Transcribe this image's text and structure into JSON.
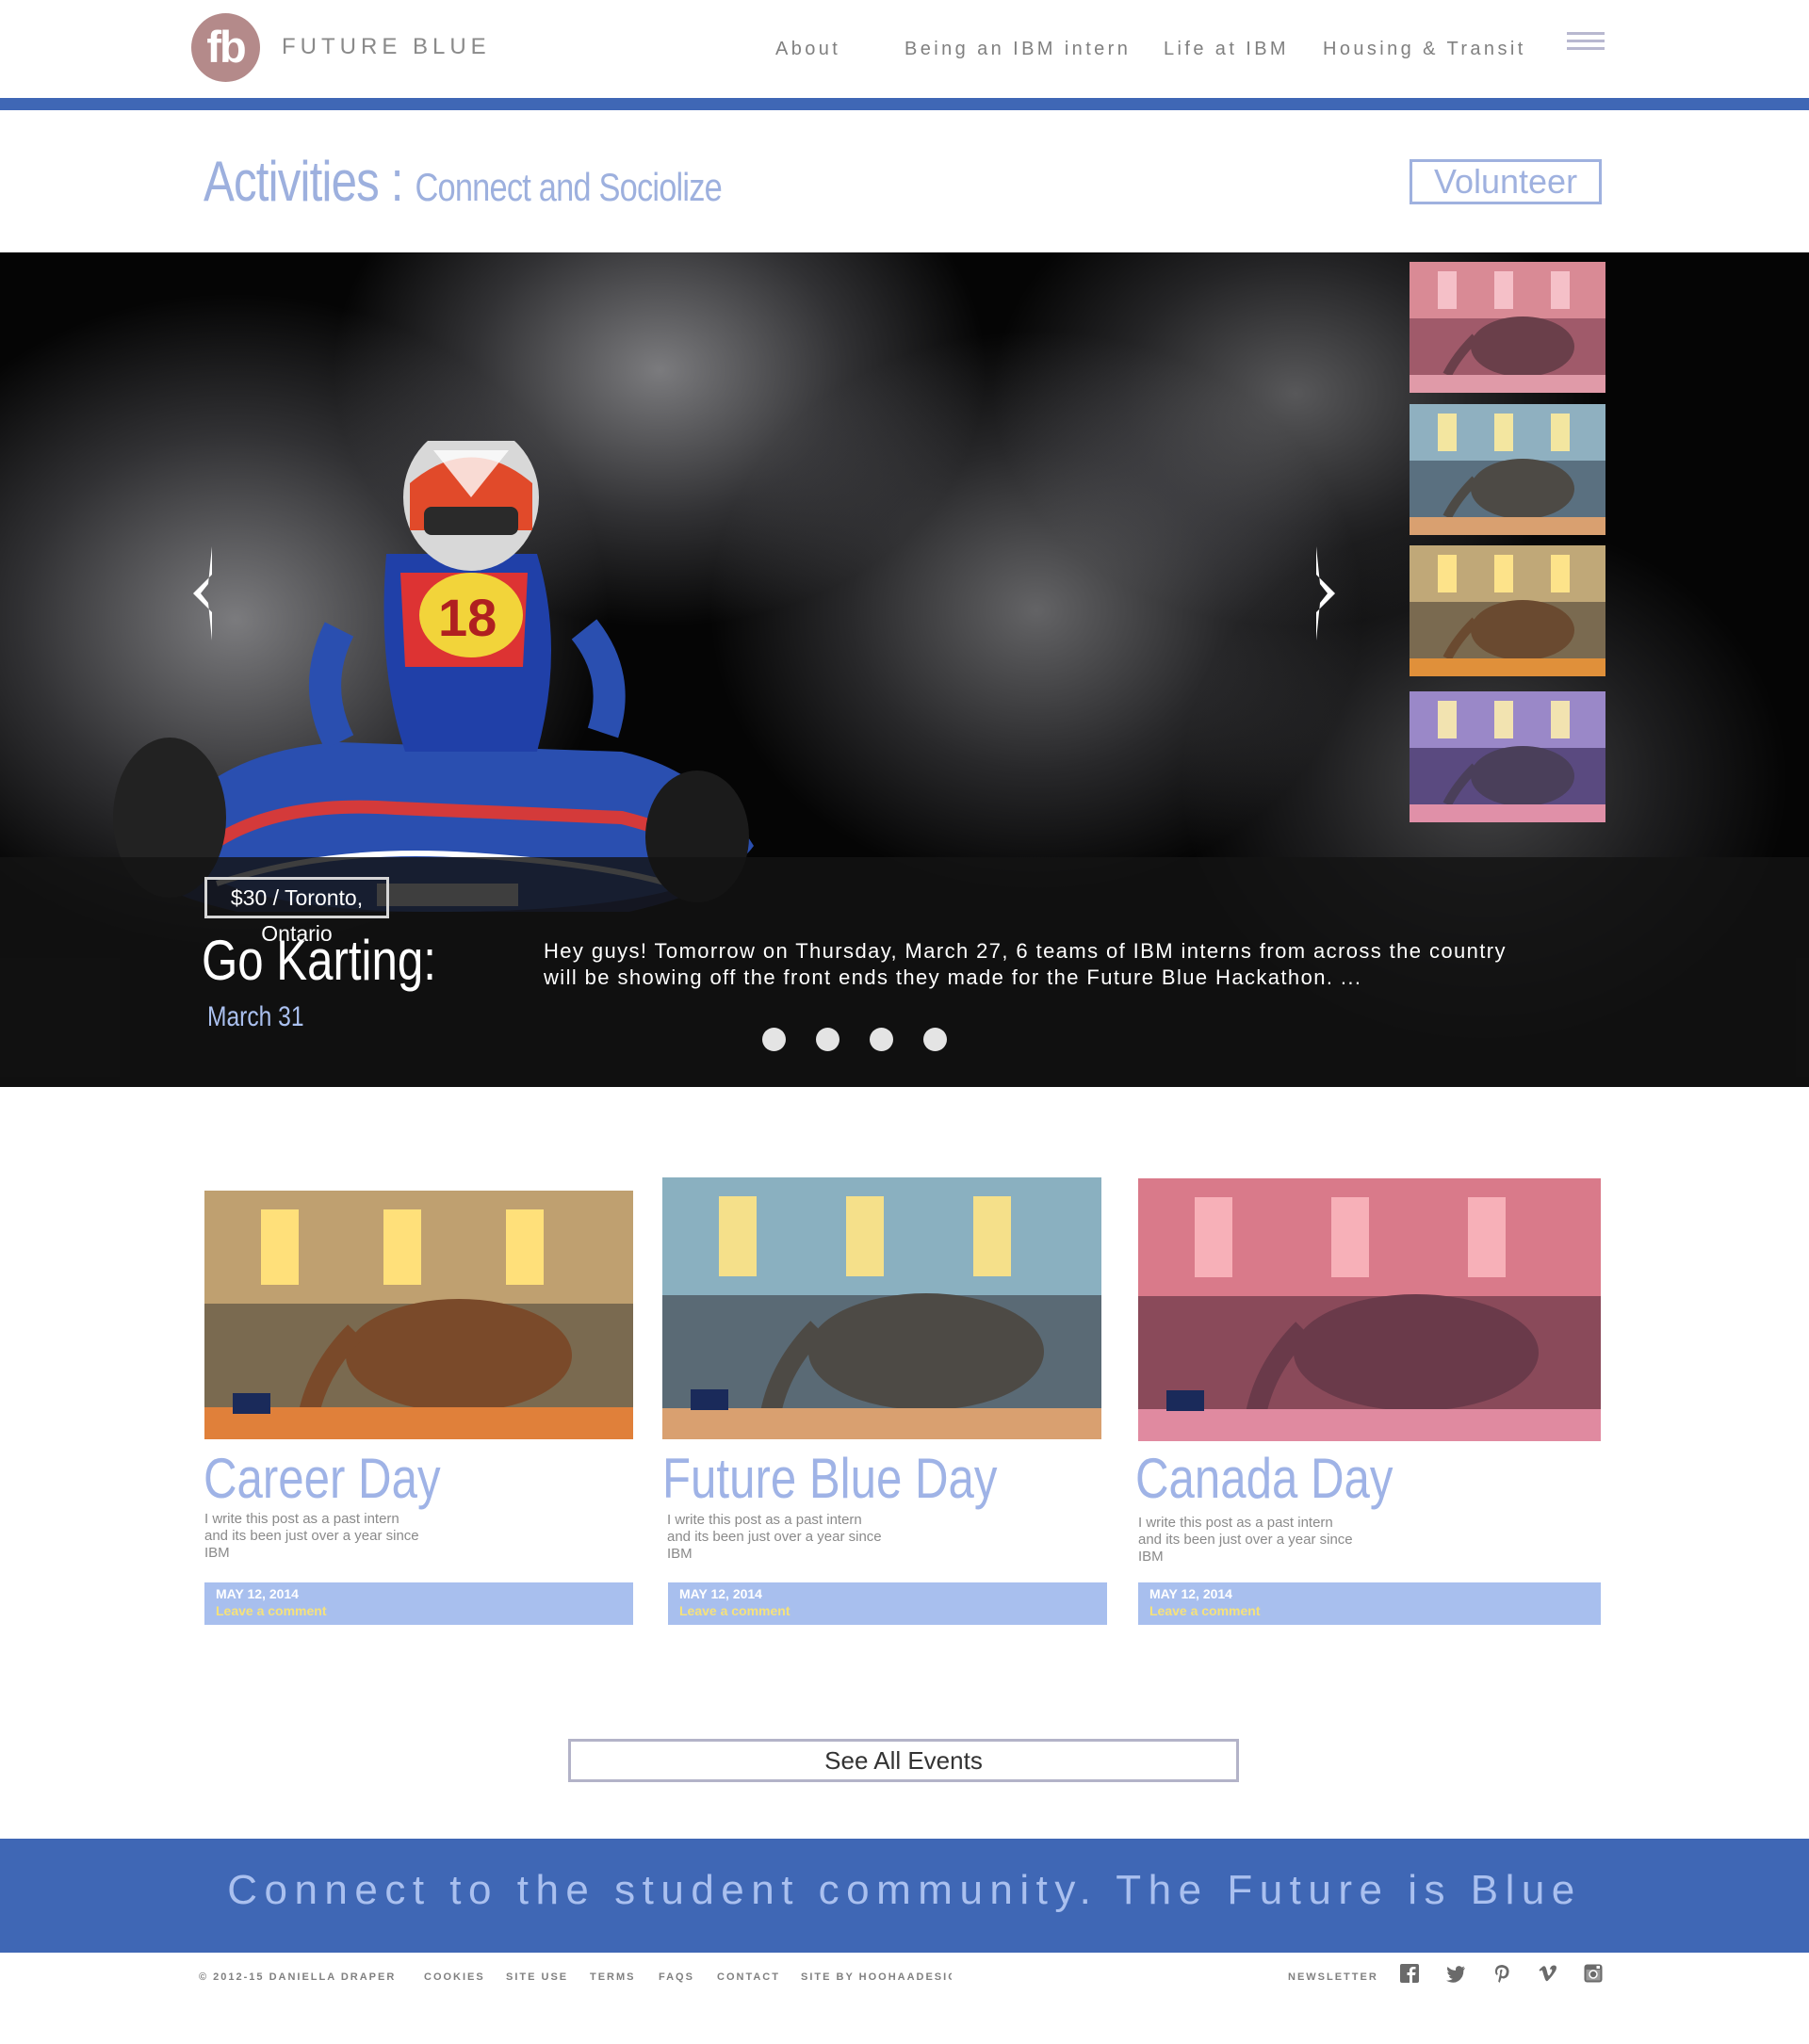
{
  "brand": {
    "logo_letters": "fb",
    "name": "FUTURE BLUE"
  },
  "nav": {
    "items": [
      "About",
      "Being an IBM intern",
      "Life at IBM",
      "Housing & Transit"
    ]
  },
  "page": {
    "title_main": "Activities :",
    "title_sub": "Connect and Sociolize",
    "volunteer_label": "Volunteer"
  },
  "hero": {
    "price_location": "$30 / Toronto, Ontario",
    "event_title": "Go Karting:",
    "event_date": "March 31",
    "description": "Hey guys! Tomorrow on Thursday, March 27, 6 teams of IBM interns from across the country will be showing off the front ends they made for the Future Blue Hackathon. ...",
    "slides_count": 4
  },
  "events": [
    {
      "title": "Career Day",
      "excerpt": "I write this post as a past intern and its been just over a year since IBM",
      "date": "MAY 12, 2014",
      "comment": "Leave a comment"
    },
    {
      "title": "Future Blue Day",
      "excerpt": "I write this post as a past intern and its been just over a year since IBM",
      "date": "MAY 12, 2014",
      "comment": "Leave a comment"
    },
    {
      "title": "Canada Day",
      "excerpt": "I write this post as a past intern and its been just over a year since IBM",
      "date": "MAY 12, 2014",
      "comment": "Leave a comment"
    }
  ],
  "see_all_label": "See All Events",
  "footer": {
    "tagline": "Connect to the student community. The Future is Blue",
    "links": [
      "© 2012-15 DANIELLA DRAPER",
      "COOKIES",
      "SITE USE",
      "TERMS",
      "FAQS",
      "CONTACT",
      "SITE BY HOOHAADESIG"
    ],
    "newsletter": "NEWSLETTER",
    "social_icons": [
      "facebook-icon",
      "twitter-icon",
      "pinterest-icon",
      "vimeo-icon",
      "instagram-icon"
    ]
  },
  "colors": {
    "brand_blue": "#3f67b5",
    "light_blue": "#9fb3e6",
    "card_bar": "#a8bfee",
    "logo_circle": "#b48a8a"
  }
}
